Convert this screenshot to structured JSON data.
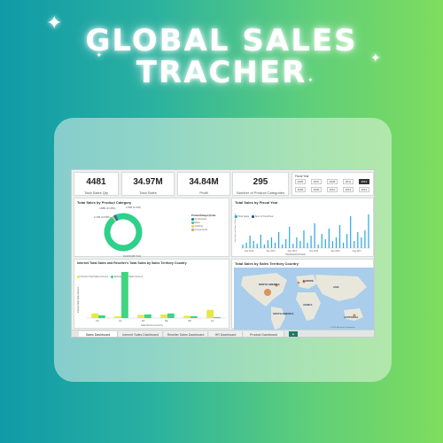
{
  "headline": [
    "GLOBAL SALES",
    "TRACHER"
  ],
  "kpis": [
    {
      "value": "4481",
      "label": "Total Sales Qty"
    },
    {
      "value": "34.97M",
      "label": "Total Sales"
    },
    {
      "value": "34.84M",
      "label": "Profit"
    },
    {
      "value": "295",
      "label": "Number of Product Categories"
    }
  ],
  "slicer": {
    "title": "Fiscal Year",
    "years": [
      "2005",
      "2007",
      "2008",
      "2011",
      "2012",
      "2006",
      "2009",
      "2010",
      "2013",
      "2014"
    ],
    "selected": "2012"
  },
  "category_chart": {
    "title": "Total Sales by Product Category",
    "legend_title": "ProductCategoryCode",
    "legend": [
      "Accessories",
      "Bikes",
      "Clothing",
      "Components"
    ],
    "colors": [
      "#1f77b4",
      "#2fd08a",
      "#e8d84a",
      "#e69a85"
    ],
    "values": [
      2.88,
      95.76,
      0.75,
      0.61
    ],
    "labels": [
      "4.88M (13.95%)",
      "4.74M (13.56%)",
      "2.20M (6.31%)",
      "33.47M (95.71%)"
    ]
  },
  "fiscal_chart": {
    "title": "Total Sales by Fiscal Year",
    "legend": [
      "Total Sales",
      "Sum of FiscalYear"
    ],
    "colors": [
      "#2aa6e8",
      "#1f4f8f"
    ],
    "x_labels": [
      "Sep 2012",
      "Sep 2013",
      "Sep 2014",
      "Sep 2015",
      "Sep 2016",
      "Aug 2017"
    ],
    "x_title": "ShipDateMonthdate",
    "y_title": "Total Sales and Sum of FiscalYear",
    "values": [
      0.1,
      0.15,
      0.35,
      0.2,
      0.12,
      0.38,
      0.1,
      0.22,
      0.3,
      0.15,
      0.45,
      0.1,
      0.25,
      0.6,
      0.12,
      0.3,
      0.2,
      0.5,
      0.15,
      0.35,
      0.7,
      0.1,
      0.4,
      0.25,
      0.55,
      0.2,
      0.3,
      0.65,
      0.15,
      0.4,
      0.9,
      0.2,
      0.45,
      0.3,
      0.5,
      0.95
    ]
  },
  "territory_chart": {
    "title": "Internet Total Sales and Reseller's Total Sales by Sales Territory Country",
    "legend": [
      "Internet Total Sales Amount",
      "Reseller Total Sales Amount"
    ],
    "colors": [
      "#e6e84a",
      "#3fd67f"
    ],
    "categories": [
      "US",
      "CA",
      "FR",
      "DE",
      "GB",
      "AU"
    ],
    "internet": [
      0.1,
      0.04,
      0.07,
      0.08,
      0.05,
      0.18
    ],
    "reseller": [
      0.06,
      1.0,
      0.08,
      0.1,
      0.04,
      0.02
    ],
    "x_title": "SalesTerritoryCountry",
    "y_title": "Internet Total Sales Amount..."
  },
  "map": {
    "title": "Total Sales by Sales Territory Country",
    "labels": [
      "NORTH AMERICA",
      "EUROPE",
      "ASIA",
      "AFRICA",
      "SOUTH AMERICA",
      "AUSTRALIA"
    ],
    "copyright": "© 2023 Microsoft Corporation"
  },
  "tabs": [
    "Sales Dashboard",
    "Internet Sales Dashboard",
    "Reseller Sales Dashboard",
    "HR Dashboard",
    "Product Dashboard"
  ],
  "add_tab": "+"
}
